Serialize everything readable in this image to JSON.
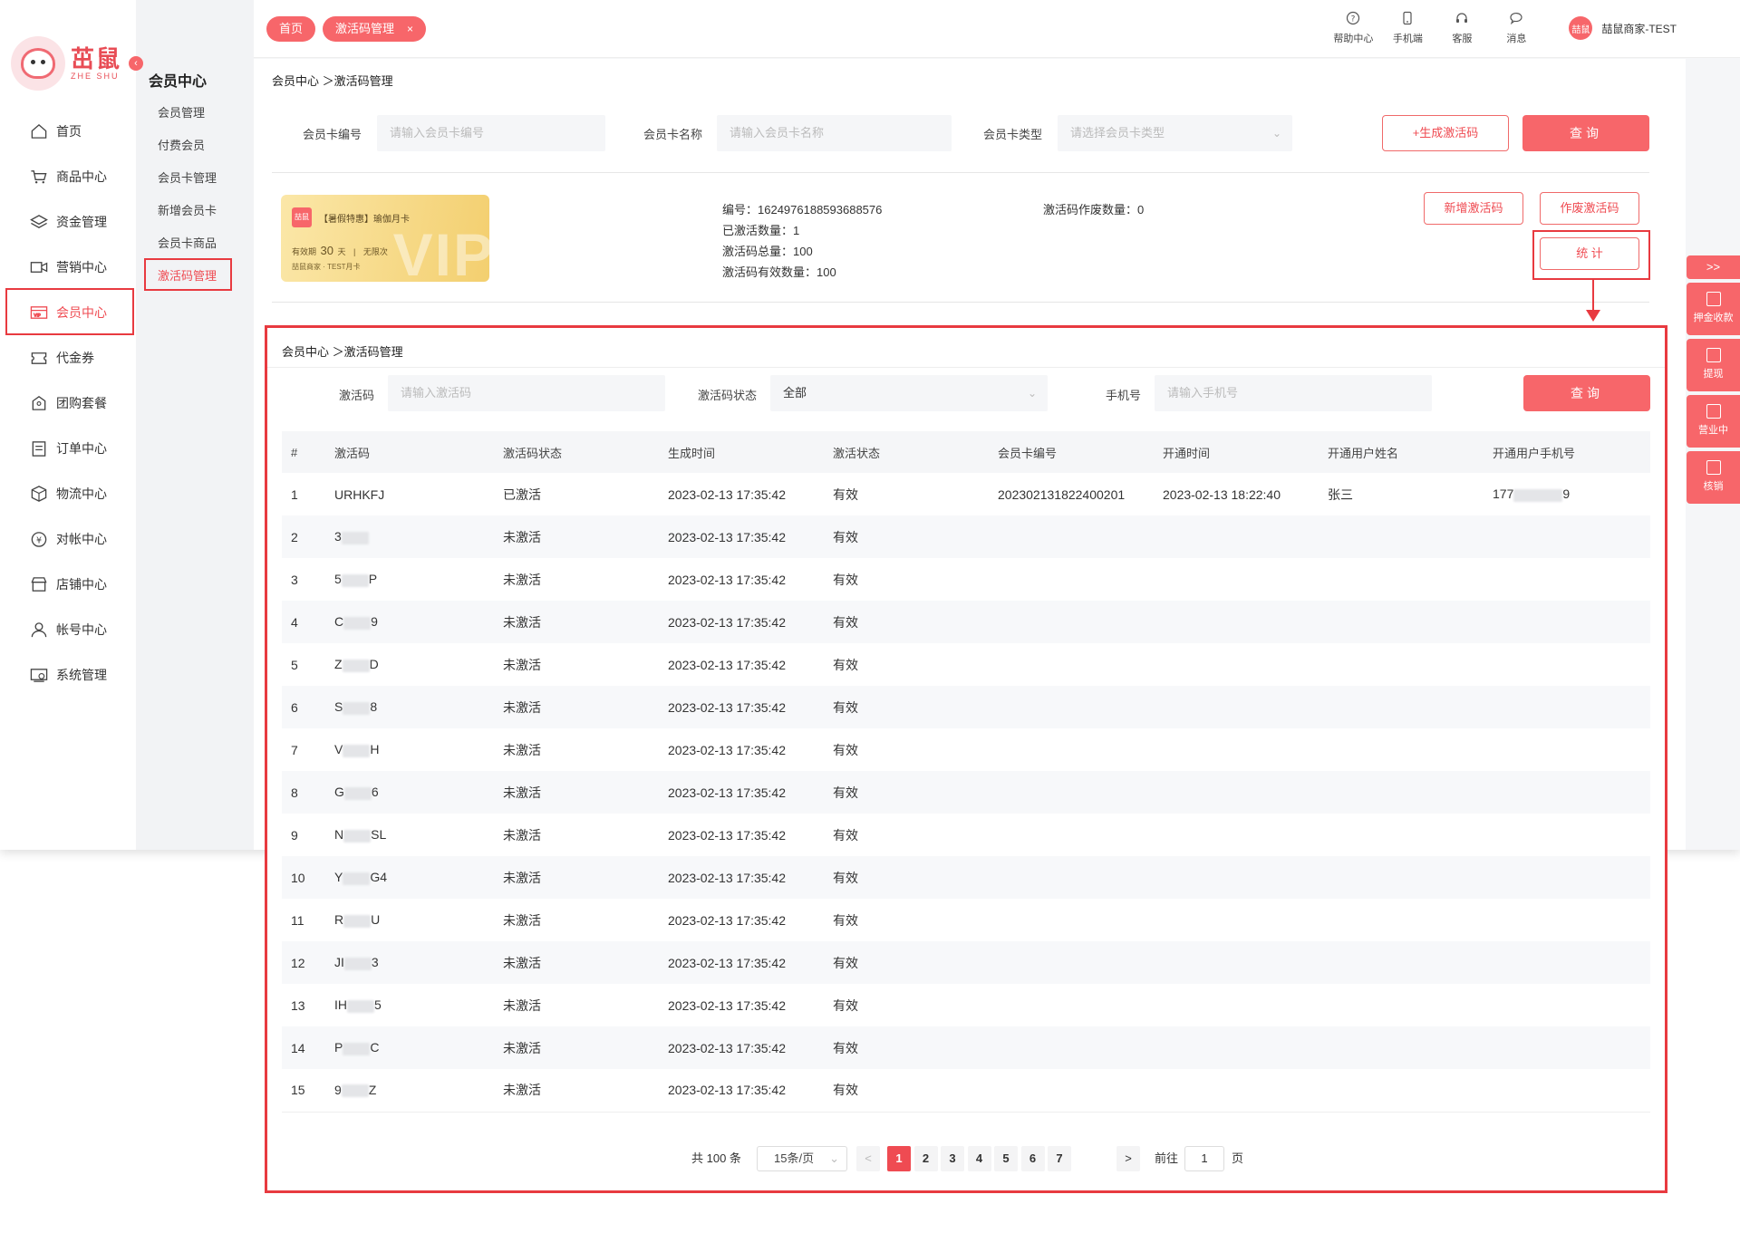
{
  "logo": {
    "cn": "茁鼠",
    "en": "ZHE SHU"
  },
  "nav": [
    {
      "label": "首页",
      "icon": "home-icon"
    },
    {
      "label": "商品中心",
      "icon": "cart-icon"
    },
    {
      "label": "资金管理",
      "icon": "layers-icon"
    },
    {
      "label": "营销中心",
      "icon": "marketing-icon"
    },
    {
      "label": "会员中心",
      "icon": "vip-card-icon",
      "active": true
    },
    {
      "label": "代金券",
      "icon": "coupon-icon"
    },
    {
      "label": "团购套餐",
      "icon": "group-buy-icon"
    },
    {
      "label": "订单中心",
      "icon": "order-icon"
    },
    {
      "label": "物流中心",
      "icon": "box-icon"
    },
    {
      "label": "对帐中心",
      "icon": "reconcile-icon"
    },
    {
      "label": "店铺中心",
      "icon": "shop-icon"
    },
    {
      "label": "帐号中心",
      "icon": "user-icon"
    },
    {
      "label": "系统管理",
      "icon": "settings-icon"
    }
  ],
  "subnav": {
    "title": "会员中心",
    "items": [
      "会员管理",
      "付费会员",
      "会员卡管理",
      "新增会员卡",
      "会员卡商品",
      "激活码管理"
    ],
    "active": "激活码管理"
  },
  "tabs": {
    "home": "首页",
    "current": "激活码管理",
    "close": "×"
  },
  "tools": [
    "帮助中心",
    "手机端",
    "客服",
    "消息"
  ],
  "user": {
    "name": "喆鼠商家-TEST",
    "avatar_text": "喆鼠"
  },
  "breadcrumb": "会员中心 ＞激活码管理",
  "filters": {
    "card_no_label": "会员卡编号",
    "card_no_placeholder": "请输入会员卡编号",
    "card_name_label": "会员卡名称",
    "card_name_placeholder": "请输入会员卡名称",
    "card_type_label": "会员卡类型",
    "card_type_placeholder": "请选择会员卡类型",
    "generate_label": "+生成激活码",
    "query_label": "查询"
  },
  "card": {
    "logo_text": "喆鼠",
    "name": "【暑假特惠】瑜伽月卡",
    "valid_prefix": "有效期",
    "valid_days": "30",
    "valid_unit": "天",
    "valid_sep": "|",
    "valid_times": "无限次",
    "shop": "喆鼠商家 · TEST月卡",
    "watermark": "VIP"
  },
  "info": {
    "no": "编号：1624976188593688576",
    "activated": "已激活数量：1",
    "total": "激活码总量：100",
    "valid": "激活码有效数量：100",
    "voided": "激活码作废数量：0"
  },
  "actions": {
    "add": "新增激活码",
    "void": "作废激活码",
    "stat": "统 计"
  },
  "popup": {
    "breadcrumb": "会员中心 ＞激活码管理",
    "code_label": "激活码",
    "code_placeholder": "请输入激活码",
    "status_label": "激活码状态",
    "status_value": "全部",
    "phone_label": "手机号",
    "phone_placeholder": "请输入手机号",
    "query_label": "查询"
  },
  "table": {
    "headers": [
      "#",
      "激活码",
      "激活码状态",
      "生成时间",
      "激活状态",
      "会员卡编号",
      "开通时间",
      "开通用户姓名",
      "开通用户手机号"
    ],
    "rows": [
      {
        "no": "1",
        "code_a": "URHKFJ",
        "code_b": "",
        "status": "已激活",
        "created": "2023-02-13 17:35:42",
        "valid": "有效",
        "card_no": "202302131822400201",
        "opened": "2023-02-13 18:22:40",
        "user": "张三",
        "phone_a": "177",
        "phone_b": "9"
      },
      {
        "no": "2",
        "code_a": "3",
        "code_b": "",
        "status": "未激活",
        "created": "2023-02-13 17:35:42",
        "valid": "有效"
      },
      {
        "no": "3",
        "code_a": "5",
        "code_b": "P",
        "status": "未激活",
        "created": "2023-02-13 17:35:42",
        "valid": "有效"
      },
      {
        "no": "4",
        "code_a": "C",
        "code_b": "9",
        "status": "未激活",
        "created": "2023-02-13 17:35:42",
        "valid": "有效"
      },
      {
        "no": "5",
        "code_a": "Z",
        "code_b": "D",
        "status": "未激活",
        "created": "2023-02-13 17:35:42",
        "valid": "有效"
      },
      {
        "no": "6",
        "code_a": "S",
        "code_b": "8",
        "status": "未激活",
        "created": "2023-02-13 17:35:42",
        "valid": "有效"
      },
      {
        "no": "7",
        "code_a": "V",
        "code_b": "H",
        "status": "未激活",
        "created": "2023-02-13 17:35:42",
        "valid": "有效"
      },
      {
        "no": "8",
        "code_a": "G",
        "code_b": "6",
        "status": "未激活",
        "created": "2023-02-13 17:35:42",
        "valid": "有效"
      },
      {
        "no": "9",
        "code_a": "N",
        "code_b": "SL",
        "status": "未激活",
        "created": "2023-02-13 17:35:42",
        "valid": "有效"
      },
      {
        "no": "10",
        "code_a": "Y",
        "code_b": "G4",
        "status": "未激活",
        "created": "2023-02-13 17:35:42",
        "valid": "有效"
      },
      {
        "no": "11",
        "code_a": "R",
        "code_b": "U",
        "status": "未激活",
        "created": "2023-02-13 17:35:42",
        "valid": "有效"
      },
      {
        "no": "12",
        "code_a": "JI",
        "code_b": "3",
        "status": "未激活",
        "created": "2023-02-13 17:35:42",
        "valid": "有效"
      },
      {
        "no": "13",
        "code_a": "IH",
        "code_b": "5",
        "status": "未激活",
        "created": "2023-02-13 17:35:42",
        "valid": "有效"
      },
      {
        "no": "14",
        "code_a": "P",
        "code_b": "C",
        "status": "未激活",
        "created": "2023-02-13 17:35:42",
        "valid": "有效"
      },
      {
        "no": "15",
        "code_a": "9",
        "code_b": "Z",
        "status": "未激活",
        "created": "2023-02-13 17:35:42",
        "valid": "有效"
      }
    ]
  },
  "pagination": {
    "total": "共 100 条",
    "page_size": "15条/页",
    "prev": "<",
    "next": ">",
    "pages": [
      "1",
      "2",
      "3",
      "4",
      "5",
      "6",
      "7"
    ],
    "current": "1",
    "goto_prefix": "前往",
    "goto_value": "1",
    "goto_suffix": "页"
  },
  "float_bar": {
    "toggle": ">>",
    "items": [
      "押金收款",
      "提现",
      "营业中",
      "核销"
    ]
  },
  "colors": {
    "accent": "#f7666a",
    "highlight": "#e83a40",
    "active_text": "#ef4b52"
  }
}
